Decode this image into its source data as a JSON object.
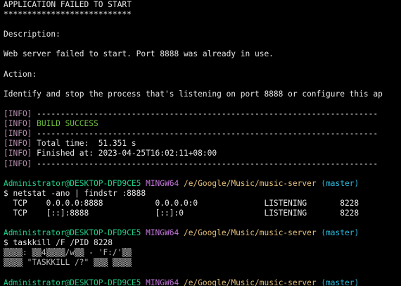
{
  "banner": {
    "title": "APPLICATION FAILED TO START",
    "underline": "***************************"
  },
  "description": {
    "heading": "Description:",
    "text": "Web server failed to start. Port 8888 was already in use."
  },
  "action": {
    "heading": "Action:",
    "text": "Identify and stop the process that's listening on port 8888 or configure this ap"
  },
  "build_log": {
    "tag": "[INFO]",
    "separator": " ------------------------------------------------------------------------",
    "status": " BUILD SUCCESS",
    "total_time": " Total time:  51.351 s",
    "finished_at": " Finished at: 2023-04-25T16:02:11+08:00"
  },
  "prompt": {
    "user_host": "Administrator@DESKTOP-DFD9CE5",
    "env": "MINGW64",
    "path": "/e/Google/Music/music-server",
    "branch": "(master)",
    "symbol": "$"
  },
  "commands": {
    "netstat": "netstat -ano | findstr :8888",
    "taskkill": "taskkill /F /PID 8228"
  },
  "netstat_rows": [
    "  TCP    0.0.0.0:8888           0.0.0.0:0              LISTENING       8228",
    "  TCP    [::]:8888              [::]:0                 LISTENING       8228"
  ],
  "taskkill_output": [
    "▒▒▒▒: ▒▒4▒▒▒▒/w▒▒ - 'F:/'▒▒",
    "▒▒▒▒ \"TASKKILL /?\" ▒▒▒ ▒▒▒▒"
  ],
  "colors": {
    "background": "#000000",
    "text": "#cccccc",
    "info_tag": "#b48ead",
    "success": "#6fbf40",
    "user_host": "#23d18b",
    "env": "#c678dd",
    "path": "#e5c07b",
    "branch": "#29b8db"
  }
}
